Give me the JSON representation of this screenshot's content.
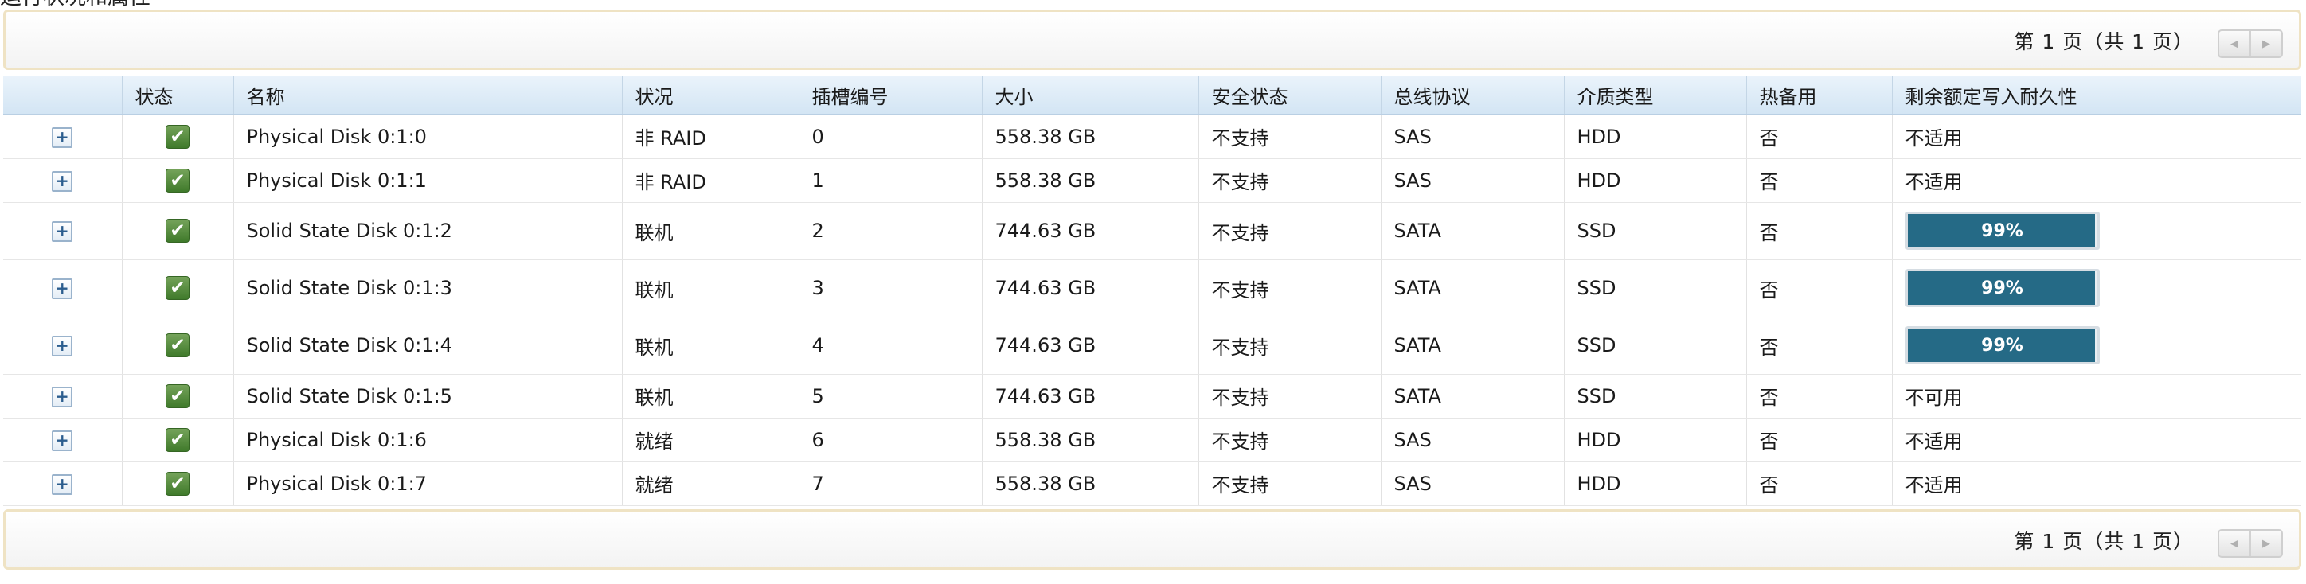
{
  "caption": "运行状况和属性",
  "pager": {
    "text": "第 1 页（共 1 页）"
  },
  "columns": [
    "",
    "状态",
    "名称",
    "状况",
    "插槽编号",
    "大小",
    "安全状态",
    "总线协议",
    "介质类型",
    "热备用",
    "剩余额定写入耐久性"
  ],
  "rows": [
    {
      "name": "Physical Disk 0:1:0",
      "state": "非 RAID",
      "slot": "0",
      "size": "558.38 GB",
      "security": "不支持",
      "bus": "SAS",
      "media": "HDD",
      "hotspare": "否",
      "endurance": "不适用"
    },
    {
      "name": "Physical Disk 0:1:1",
      "state": "非 RAID",
      "slot": "1",
      "size": "558.38 GB",
      "security": "不支持",
      "bus": "SAS",
      "media": "HDD",
      "hotspare": "否",
      "endurance": "不适用"
    },
    {
      "name": "Solid State Disk 0:1:2",
      "state": "联机",
      "slot": "2",
      "size": "744.63 GB",
      "security": "不支持",
      "bus": "SATA",
      "media": "SSD",
      "hotspare": "否",
      "endurance_label": "99%",
      "endurance_pct": 99
    },
    {
      "name": "Solid State Disk 0:1:3",
      "state": "联机",
      "slot": "3",
      "size": "744.63 GB",
      "security": "不支持",
      "bus": "SATA",
      "media": "SSD",
      "hotspare": "否",
      "endurance_label": "99%",
      "endurance_pct": 99
    },
    {
      "name": "Solid State Disk 0:1:4",
      "state": "联机",
      "slot": "4",
      "size": "744.63 GB",
      "security": "不支持",
      "bus": "SATA",
      "media": "SSD",
      "hotspare": "否",
      "endurance_label": "99%",
      "endurance_pct": 99
    },
    {
      "name": "Solid State Disk 0:1:5",
      "state": "联机",
      "slot": "5",
      "size": "744.63 GB",
      "security": "不支持",
      "bus": "SATA",
      "media": "SSD",
      "hotspare": "否",
      "endurance": "不可用"
    },
    {
      "name": "Physical Disk 0:1:6",
      "state": "就绪",
      "slot": "6",
      "size": "558.38 GB",
      "security": "不支持",
      "bus": "SAS",
      "media": "HDD",
      "hotspare": "否",
      "endurance": "不适用"
    },
    {
      "name": "Physical Disk 0:1:7",
      "state": "就绪",
      "slot": "7",
      "size": "558.38 GB",
      "security": "不支持",
      "bus": "SAS",
      "media": "HDD",
      "hotspare": "否",
      "endurance": "不适用"
    }
  ],
  "icons": {
    "expand": "plus-icon",
    "status": "check-icon",
    "pager_prev": "triangle-left-icon",
    "pager_next": "triangle-right-icon"
  },
  "colors": {
    "status_ok": "#4a8a34",
    "progress_fill": "#256a86",
    "header_bg": "#dbe9f6",
    "pager_border": "#efe3c4"
  }
}
